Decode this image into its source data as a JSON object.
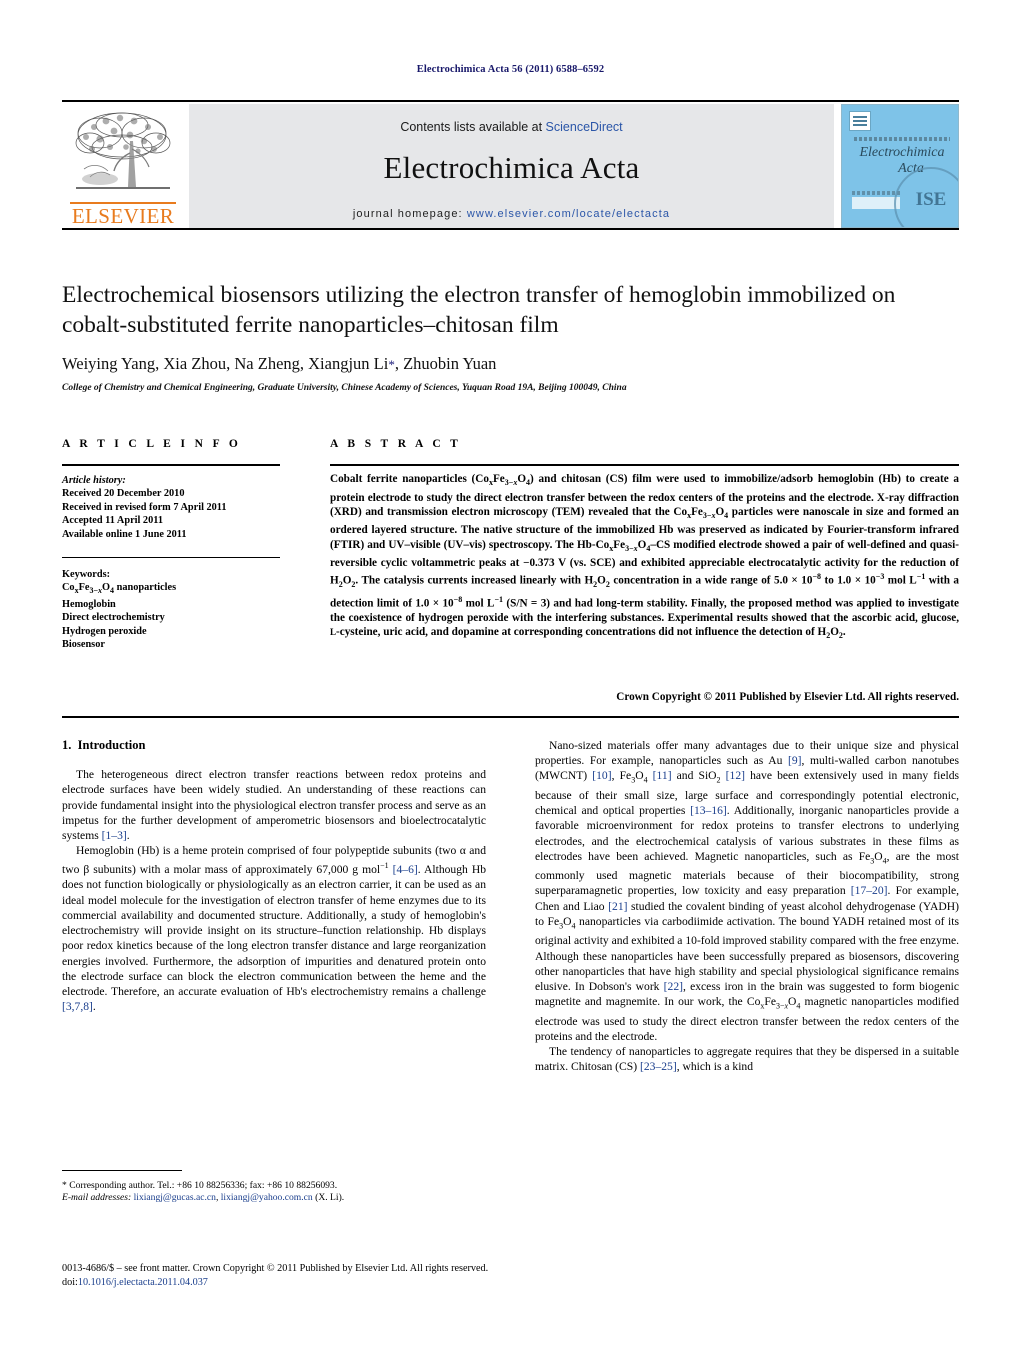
{
  "running_head": "Electrochimica Acta 56 (2011) 6588–6592",
  "masthead": {
    "contents_prefix": "Contents lists available at ",
    "sciencedirect": "ScienceDirect",
    "journal_title": "Electrochimica Acta",
    "homepage_label": "journal homepage: ",
    "homepage_url": "www.elsevier.com/locate/electacta",
    "publisher_name": "ELSEVIER",
    "publisher_logo_icon": "elsevier-tree-icon",
    "cover_title_line1": "Electrochimica",
    "cover_title_line2": "Acta",
    "cover_seal_label": "ISE",
    "accent_link_color": "#2b56a8",
    "elsevier_orange": "#e87b1e",
    "cover_blue": "#7ec3e8"
  },
  "article": {
    "title": "Electrochemical biosensors utilizing the electron transfer of hemoglobin immobilized on cobalt-substituted ferrite nanoparticles–chitosan film",
    "authors": "Weiying Yang, Xia Zhou, Na Zheng, Xiangjun Li",
    "authors_tail": ", Zhuobin Yuan",
    "corresponding_marker": "*",
    "affiliation": "College of Chemistry and Chemical Engineering, Graduate University, Chinese Academy of Sciences, Yuquan Road 19A, Beijing 100049, China"
  },
  "info": {
    "heading": "A R T I C L E    I N F O",
    "history_label": "Article history:",
    "history": [
      "Received 20 December 2010",
      "Received in revised form 7 April 2011",
      "Accepted 11 April 2011",
      "Available online 1 June 2011"
    ],
    "keywords_label": "Keywords:",
    "keywords": [
      "CoxFe3−xO4 nanoparticles",
      "Hemoglobin",
      "Direct electrochemistry",
      "Hydrogen peroxide",
      "Biosensor"
    ]
  },
  "abstract": {
    "heading": "A B S T R A C T",
    "text": "Cobalt ferrite nanoparticles (CoxFe3−xO4) and chitosan (CS) film were used to immobilize/adsorb hemoglobin (Hb) to create a protein electrode to study the direct electron transfer between the redox centers of the proteins and the electrode. X-ray diffraction (XRD) and transmission electron microscopy (TEM) revealed that the CoxFe3−xO4 particles were nanoscale in size and formed an ordered layered structure. The native structure of the immobilized Hb was preserved as indicated by Fourier-transform infrared (FTIR) and UV–visible (UV–vis) spectroscopy. The Hb-CoxFe3−xO4–CS modified electrode showed a pair of well-defined and quasi-reversible cyclic voltammetric peaks at −0.373 V (vs. SCE) and exhibited appreciable electrocatalytic activity for the reduction of H2O2. The catalysis currents increased linearly with H2O2 concentration in a wide range of 5.0 × 10−8 to 1.0 × 10−3 mol L−1 with a detection limit of 1.0 × 10−8 mol L−1 (S/N = 3) and had long-term stability. Finally, the proposed method was applied to investigate the coexistence of hydrogen peroxide with the interfering substances. Experimental results showed that the ascorbic acid, glucose, L-cysteine, uric acid, and dopamine at corresponding concentrations did not influence the detection of H2O2.",
    "copyright": "Crown Copyright © 2011 Published by Elsevier Ltd. All rights reserved."
  },
  "body": {
    "section_number": "1.",
    "section_title": "Introduction",
    "left_paragraphs": [
      "The heterogeneous direct electron transfer reactions between redox proteins and electrode surfaces have been widely studied. An understanding of these reactions can provide fundamental insight into the physiological electron transfer process and serve as an impetus for the further development of amperometric biosensors and bioelectrocatalytic systems [1–3].",
      "Hemoglobin (Hb) is a heme protein comprised of four polypeptide subunits (two α and two β subunits) with a molar mass of approximately 67,000 g mol−1 [4–6]. Although Hb does not function biologically or physiologically as an electron carrier, it can be used as an ideal model molecule for the investigation of electron transfer of heme enzymes due to its commercial availability and documented structure. Additionally, a study of hemoglobin's electrochemistry will provide insight on its structure–function relationship. Hb displays poor redox kinetics because of the long electron transfer distance and large reorganization energies involved. Furthermore, the adsorption of impurities and denatured protein onto the electrode surface can block the electron communication between the heme and the electrode. Therefore, an accurate evaluation of Hb's electrochemistry remains a challenge [3,7,8]."
    ],
    "right_paragraphs": [
      "Nano-sized materials offer many advantages due to their unique size and physical properties. For example, nanoparticles such as Au [9], multi-walled carbon nanotubes (MWCNT) [10], Fe3O4 [11] and SiO2 [12] have been extensively used in many fields because of their small size, large surface and correspondingly potential electronic, chemical and optical properties [13–16]. Additionally, inorganic nanoparticles provide a favorable microenvironment for redox proteins to transfer electrons to underlying electrodes, and the electrochemical catalysis of various substrates in these films as electrodes have been achieved. Magnetic nanoparticles, such as Fe3O4, are the most commonly used magnetic materials because of their biocompatibility, strong superparamagnetic properties, low toxicity and easy preparation [17–20]. For example, Chen and Liao [21] studied the covalent binding of yeast alcohol dehydrogenase (YADH) to Fe3O4 nanoparticles via carbodiimide activation. The bound YADH retained most of its original activity and exhibited a 10-fold improved stability compared with the free enzyme. Although these nanoparticles have been successfully prepared as biosensors, discovering other nanoparticles that have high stability and special physiological significance remains elusive. In Dobson's work [22], excess iron in the brain was suggested to form biogenic magnetite and magnemite. In our work, the CoxFe3−xO4 magnetic nanoparticles modified electrode was used to study the direct electron transfer between the redox centers of the proteins and the electrode.",
      "The tendency of nanoparticles to aggregate requires that they be dispersed in a suitable matrix. Chitosan (CS) [23–25], which is a kind"
    ]
  },
  "footnote": {
    "marker": "*",
    "corresponding": "Corresponding author. Tel.: +86 10 88256336; fax: +86 10 88256093.",
    "email_label": "E-mail addresses:",
    "email1": "lixiangj@gucas.ac.cn",
    "email2": "lixiangj@yahoo.com.cn",
    "email_attrib": "(X. Li)."
  },
  "footer": {
    "issn_line": "0013-4686/$ – see front matter. Crown Copyright © 2011 Published by Elsevier Ltd. All rights reserved.",
    "doi_label": "doi:",
    "doi": "10.1016/j.electacta.2011.04.037"
  }
}
